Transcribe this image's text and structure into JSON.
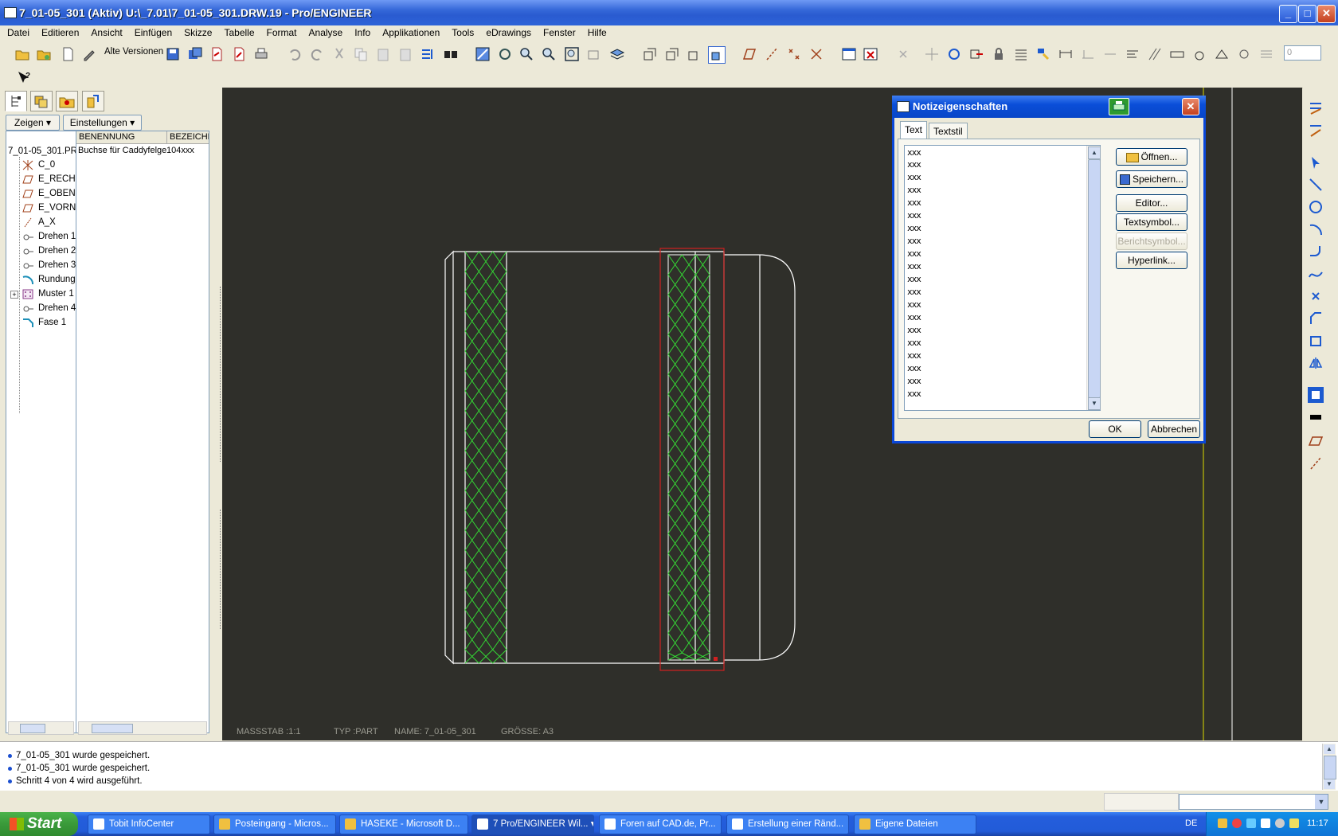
{
  "window": {
    "title": "7_01-05_301 (Aktiv) U:\\_7.01\\7_01-05_301.DRW.19 - Pro/ENGINEER"
  },
  "menu": [
    "Datei",
    "Editieren",
    "Ansicht",
    "Einfügen",
    "Skizze",
    "Tabelle",
    "Format",
    "Analyse",
    "Info",
    "Applikationen",
    "Tools",
    "eDrawings",
    "Fenster",
    "Hilfe"
  ],
  "toolbar": {
    "versions_label": "Alte Versionen",
    "spin_value": "0"
  },
  "leftpanel": {
    "show_label": "Zeigen",
    "settings_label": "Einstellungen",
    "col_name": "BENENNUNG",
    "col_id": "BEZEICHN",
    "root": {
      "name": "7_01-05_301.PR",
      "desc": "Buchse für Caddyfelge",
      "id": "104xxx"
    },
    "items": [
      {
        "label": "C_0",
        "icon": "csys-icon"
      },
      {
        "label": "E_RECH",
        "icon": "datum-plane-icon"
      },
      {
        "label": "E_OBEN",
        "icon": "datum-plane-icon"
      },
      {
        "label": "E_VORN",
        "icon": "datum-plane-icon"
      },
      {
        "label": "A_X",
        "icon": "datum-axis-icon"
      },
      {
        "label": "Drehen 1",
        "icon": "revolve-icon"
      },
      {
        "label": "Drehen 2",
        "icon": "revolve-icon"
      },
      {
        "label": "Drehen 3",
        "icon": "revolve-icon"
      },
      {
        "label": "Rundung",
        "icon": "round-icon"
      },
      {
        "label": "Muster 1",
        "icon": "pattern-icon"
      },
      {
        "label": "Drehen 4",
        "icon": "revolve-icon"
      },
      {
        "label": "Fase 1",
        "icon": "chamfer-icon"
      }
    ]
  },
  "drawing": {
    "massstab": "MASSSTAB :1:1",
    "typ": "TYP :PART",
    "name": "NAME: 7_01-05_301",
    "groesse": "GRÖSSE: A3"
  },
  "dialog": {
    "title": "Notizeigenschaften",
    "tabs": [
      "Text",
      "Textstil"
    ],
    "lines": [
      "xxx",
      "xxx",
      "xxx",
      "xxx",
      "xxx",
      "xxx",
      "xxx",
      "xxx",
      "xxx",
      "xxx",
      "xxx",
      "xxx",
      "xxx",
      "xxx",
      "xxx",
      "xxx",
      "xxx",
      "xxx",
      "xxx",
      "xxx"
    ],
    "buttons": {
      "open": "Öffnen...",
      "save": "Speichern...",
      "editor": "Editor...",
      "textsymbol": "Textsymbol...",
      "reportsymbol": "Berichtsymbol...",
      "hyperlink": "Hyperlink...",
      "ok": "OK",
      "cancel": "Abbrechen"
    }
  },
  "messages": [
    "7_01-05_301 wurde gespeichert.",
    "7_01-05_301 wurde gespeichert.",
    "Schritt 4 von 4 wird ausgeführt."
  ],
  "taskbar": {
    "start": "Start",
    "tasks": [
      "Tobit InfoCenter",
      "Posteingang - Micros...",
      "HASEKE - Microsoft D...",
      "7 Pro/ENGINEER Wil...",
      "Foren auf CAD.de, Pr...",
      "Erstellung einer Ränd...",
      "Eigene Dateien"
    ],
    "lang": "DE",
    "clock": "11:17"
  },
  "colors": {
    "canvas": "#2f2f2a",
    "knurl": "#34d634",
    "selection": "#d02020",
    "accent": "#0a47d8"
  }
}
